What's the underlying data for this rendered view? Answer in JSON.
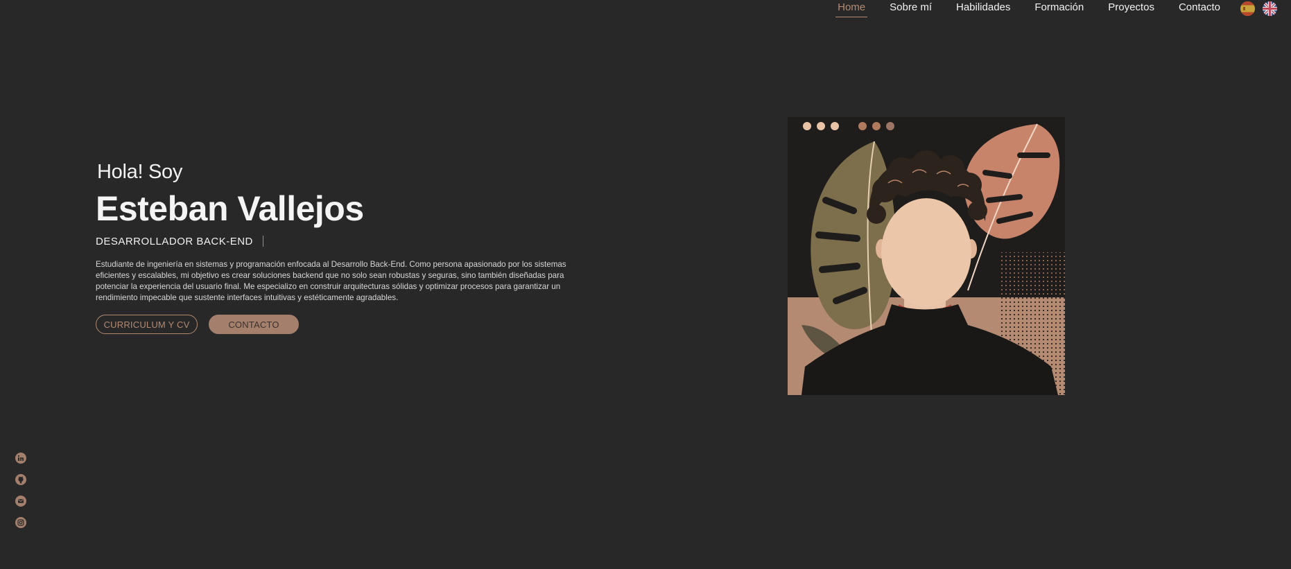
{
  "nav": {
    "links": [
      "Home",
      "Sobre mí",
      "Habilidades",
      "Formación",
      "Proyectos",
      "Contacto"
    ],
    "active": "Home"
  },
  "languages": [
    {
      "name": "spanish-flag-icon"
    },
    {
      "name": "uk-flag-icon"
    }
  ],
  "hero": {
    "greeting": "Hola! Soy",
    "name": "Esteban Vallejos",
    "role": "DESARROLLADOR BACK-END",
    "bio": "Estudiante de ingeniería en sistemas y programación enfocada al Desarrollo Back-End. Como persona apasionado por los sistemas eficientes y escalables, mi objetivo es crear soluciones backend que no solo sean robustas y seguras, sino también diseñadas para potenciar la experiencia del usuario final. Me especializo en construir arquitecturas sólidas y optimizar procesos para garantizar un rendimiento impecable que sustente interfaces intuitivas y estéticamente agradables.",
    "cv_button": "CURRICULUM Y CV",
    "contact_button": "CONTACTO"
  },
  "social": [
    "linkedin-icon",
    "github-icon",
    "email-icon",
    "instagram-icon"
  ],
  "colors": {
    "background": "#282828",
    "accent": "#b48a72",
    "button_fill": "#a4806c",
    "text": "#f2f2f2"
  }
}
